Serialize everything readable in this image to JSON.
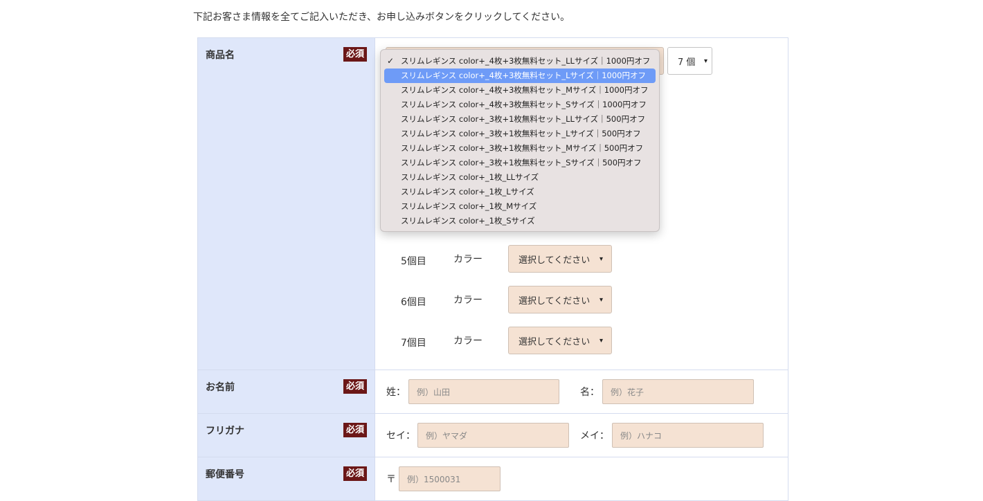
{
  "intro": "下記お客さま情報を全てご記入いただき、お申し込みボタンをクリックしてください。",
  "required_label": "必須",
  "rows": {
    "product": "商品名",
    "name": "お名前",
    "kana": "フリガナ",
    "zip": "郵便番号"
  },
  "product": {
    "quantity_select": "7 個",
    "dropdown_options": [
      "スリムレギンス color+_4枚+3枚無料セット_LLサイズ｜1000円オフ",
      "スリムレギンス color+_4枚+3枚無料セット_Lサイズ｜1000円オフ",
      "スリムレギンス color+_4枚+3枚無料セット_Mサイズ｜1000円オフ",
      "スリムレギンス color+_4枚+3枚無料セット_Sサイズ｜1000円オフ",
      "スリムレギンス color+_3枚+1枚無料セット_LLサイズ｜500円オフ",
      "スリムレギンス color+_3枚+1枚無料セット_Lサイズ｜500円オフ",
      "スリムレギンス color+_3枚+1枚無料セット_Mサイズ｜500円オフ",
      "スリムレギンス color+_3枚+1枚無料セット_Sサイズ｜500円オフ",
      "スリムレギンス color+_1枚_LLサイズ",
      "スリムレギンス color+_1枚_Lサイズ",
      "スリムレギンス color+_1枚_Mサイズ",
      "スリムレギンス color+_1枚_Sサイズ"
    ],
    "checked_index": 0,
    "highlighted_index": 1,
    "check_mark": "✓",
    "items": [
      {
        "no": "5個目",
        "color_label": "カラー",
        "select": "選択してください"
      },
      {
        "no": "6個目",
        "color_label": "カラー",
        "select": "選択してください"
      },
      {
        "no": "7個目",
        "color_label": "カラー",
        "select": "選択してください"
      }
    ]
  },
  "name": {
    "last_label": "姓：",
    "last_placeholder": "例）山田",
    "first_label": "名：",
    "first_placeholder": "例）花子"
  },
  "kana": {
    "last_label": "セイ：",
    "last_placeholder": "例）ヤマダ",
    "first_label": "メイ：",
    "first_placeholder": "例）ハナコ"
  },
  "zip": {
    "mark": "〒",
    "placeholder": "例）1500031"
  },
  "colors": {
    "label_bg": "#dfe7fa",
    "input_bg": "#f5e2d3",
    "required_bg": "#6b1717",
    "highlight": "#6e9bf7"
  }
}
